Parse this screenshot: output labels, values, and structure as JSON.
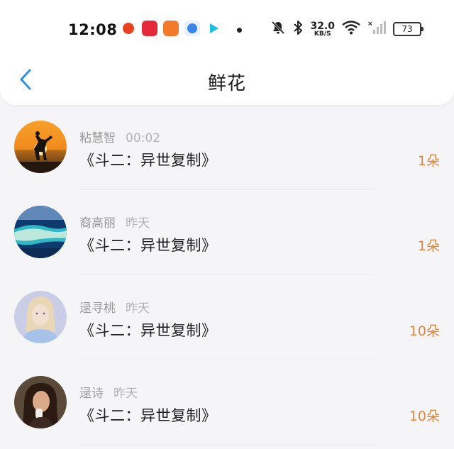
{
  "status_bar": {
    "time": "12:08",
    "net_speed_value": "32.0",
    "net_speed_unit": "KB/S",
    "battery": "73",
    "icons": [
      "app-icon-1",
      "app-icon-2",
      "app-icon-3",
      "app-icon-4",
      "app-icon-5",
      "more-dot",
      "mute-bell-icon",
      "bluetooth-icon",
      "wifi-icon",
      "signal-icon",
      "battery-icon"
    ]
  },
  "header": {
    "title": "鲜花",
    "back_icon": "chevron-left-icon"
  },
  "list": {
    "items": [
      {
        "name": "粘慧智",
        "time": "00:02",
        "title": "《斗二：异世复制》",
        "count": "1朵",
        "avatar": "sunset-avatar"
      },
      {
        "name": "裔高丽",
        "time": "昨天",
        "title": "《斗二：异世复制》",
        "count": "1朵",
        "avatar": "ocean-avatar"
      },
      {
        "name": "逯寻桃",
        "time": "昨天",
        "title": "《斗二：异世复制》",
        "count": "10朵",
        "avatar": "portrait-avatar"
      },
      {
        "name": "逯诗",
        "time": "昨天",
        "title": "《斗二：异世复制》",
        "count": "10朵",
        "avatar": "woman-avatar"
      }
    ]
  },
  "colors": {
    "accent": "#2e8fe8",
    "count": "#e0853e",
    "background": "#f5f5f7"
  }
}
